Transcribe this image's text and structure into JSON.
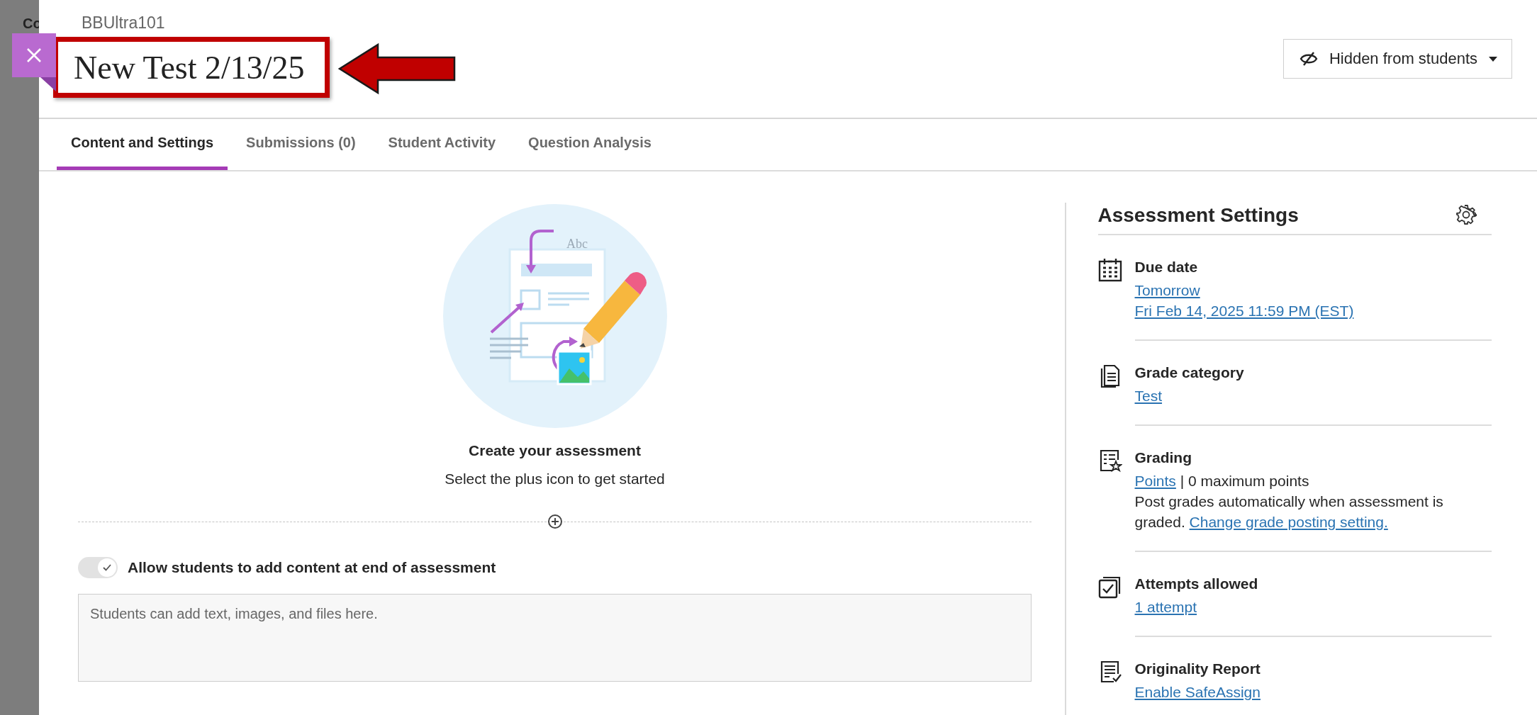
{
  "backdrop_text": "Co",
  "course": "BBUltra101",
  "title": "New Test 2/13/25",
  "visibility_button": {
    "label": "Hidden from students"
  },
  "tabs": [
    {
      "label": "Content and Settings",
      "selected": true
    },
    {
      "label": "Submissions (0)",
      "selected": false
    },
    {
      "label": "Student Activity",
      "selected": false
    },
    {
      "label": "Question Analysis",
      "selected": false
    }
  ],
  "illustration_text": "Abc",
  "empty_state": {
    "heading": "Create your assessment",
    "text": "Select the plus icon to get started"
  },
  "allow_toggle": {
    "label": "Allow students to add content at end of assessment",
    "on": true
  },
  "content_field": {
    "placeholder": "Students can add text, images, and files here."
  },
  "settings": {
    "title": "Assessment Settings",
    "items": [
      {
        "kind": "calendar",
        "label": "Due date",
        "lines": [
          {
            "segments": [
              {
                "text": "Tomorrow",
                "link": true
              }
            ]
          },
          {
            "segments": [
              {
                "text": "Fri Feb 14, 2025 11:59 PM (EST)",
                "link": true
              }
            ]
          }
        ]
      },
      {
        "kind": "document",
        "label": "Grade category",
        "lines": [
          {
            "segments": [
              {
                "text": "Test",
                "link": true
              }
            ]
          }
        ]
      },
      {
        "kind": "grading",
        "label": "Grading",
        "lines": [
          {
            "segments": [
              {
                "text": "Points",
                "link": true
              },
              {
                "text": "| 0 maximum points",
                "link": false
              }
            ]
          },
          {
            "segments": [
              {
                "text": "Post grades automatically when assessment is graded.",
                "link": false
              },
              {
                "text": "Change grade posting setting.",
                "link": true
              }
            ]
          }
        ]
      },
      {
        "kind": "attempts",
        "label": "Attempts allowed",
        "lines": [
          {
            "segments": [
              {
                "text": "1 attempt",
                "link": true
              }
            ]
          }
        ]
      },
      {
        "kind": "originality",
        "label": "Originality Report",
        "lines": [
          {
            "segments": [
              {
                "text": "Enable SafeAssign",
                "link": true
              }
            ]
          }
        ]
      }
    ]
  }
}
